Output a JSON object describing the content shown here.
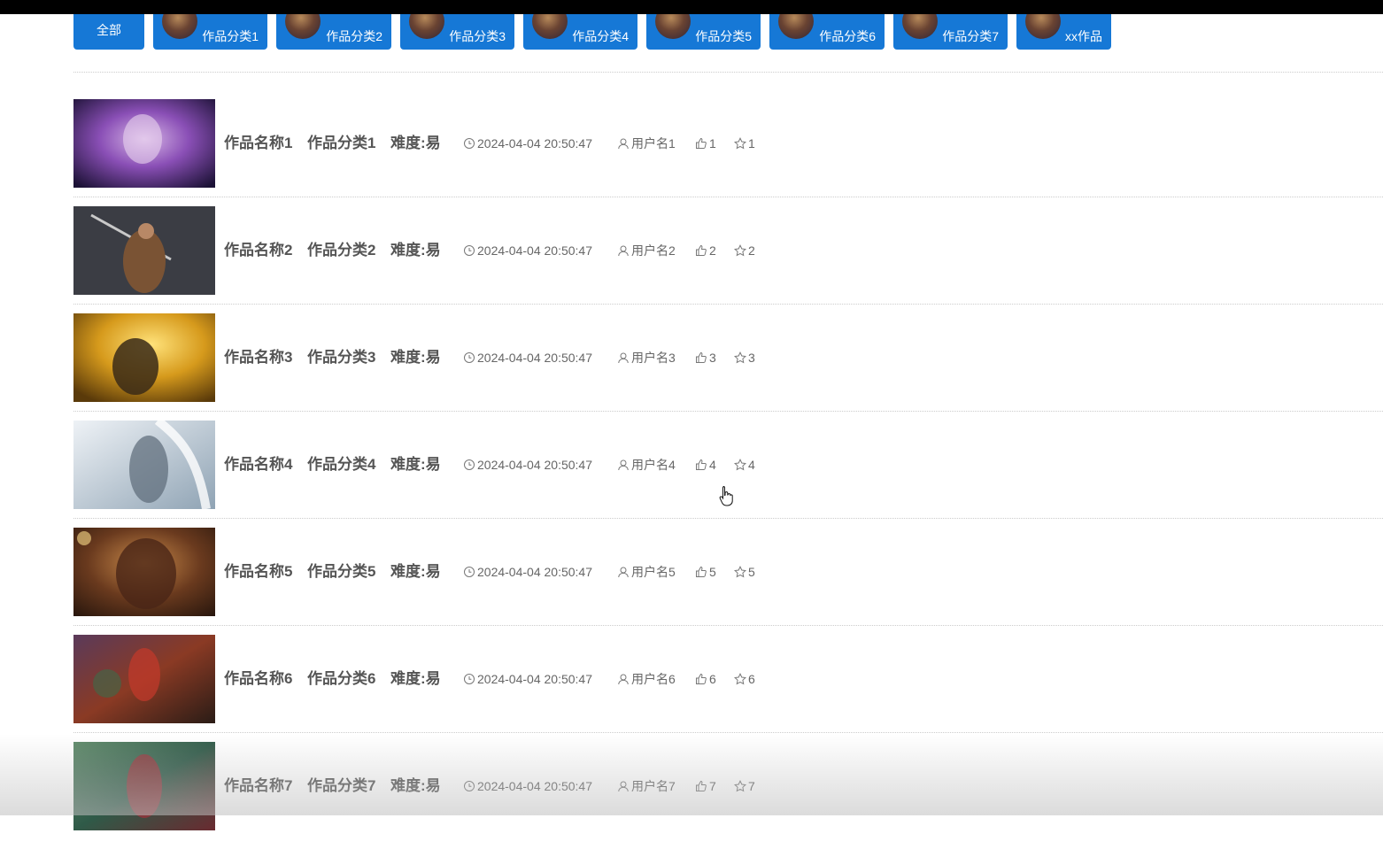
{
  "categories": [
    {
      "label": "全部"
    },
    {
      "label": "作品分类1"
    },
    {
      "label": "作品分类2"
    },
    {
      "label": "作品分类3"
    },
    {
      "label": "作品分类4"
    },
    {
      "label": "作品分类5"
    },
    {
      "label": "作品分类6"
    },
    {
      "label": "作品分类7"
    },
    {
      "label": "xx作品"
    }
  ],
  "items": [
    {
      "name": "作品名称1",
      "category": "作品分类1",
      "difficulty": "难度:易",
      "time": "2024-04-04 20:50:47",
      "user": "用户名1",
      "likes": "1",
      "stars": "1"
    },
    {
      "name": "作品名称2",
      "category": "作品分类2",
      "difficulty": "难度:易",
      "time": "2024-04-04 20:50:47",
      "user": "用户名2",
      "likes": "2",
      "stars": "2"
    },
    {
      "name": "作品名称3",
      "category": "作品分类3",
      "difficulty": "难度:易",
      "time": "2024-04-04 20:50:47",
      "user": "用户名3",
      "likes": "3",
      "stars": "3"
    },
    {
      "name": "作品名称4",
      "category": "作品分类4",
      "difficulty": "难度:易",
      "time": "2024-04-04 20:50:47",
      "user": "用户名4",
      "likes": "4",
      "stars": "4"
    },
    {
      "name": "作品名称5",
      "category": "作品分类5",
      "difficulty": "难度:易",
      "time": "2024-04-04 20:50:47",
      "user": "用户名5",
      "likes": "5",
      "stars": "5"
    },
    {
      "name": "作品名称6",
      "category": "作品分类6",
      "difficulty": "难度:易",
      "time": "2024-04-04 20:50:47",
      "user": "用户名6",
      "likes": "6",
      "stars": "6"
    },
    {
      "name": "作品名称7",
      "category": "作品分类7",
      "difficulty": "难度:易",
      "time": "2024-04-04 20:50:47",
      "user": "用户名7",
      "likes": "7",
      "stars": "7"
    }
  ],
  "colors": {
    "accent": "#1678d6"
  }
}
